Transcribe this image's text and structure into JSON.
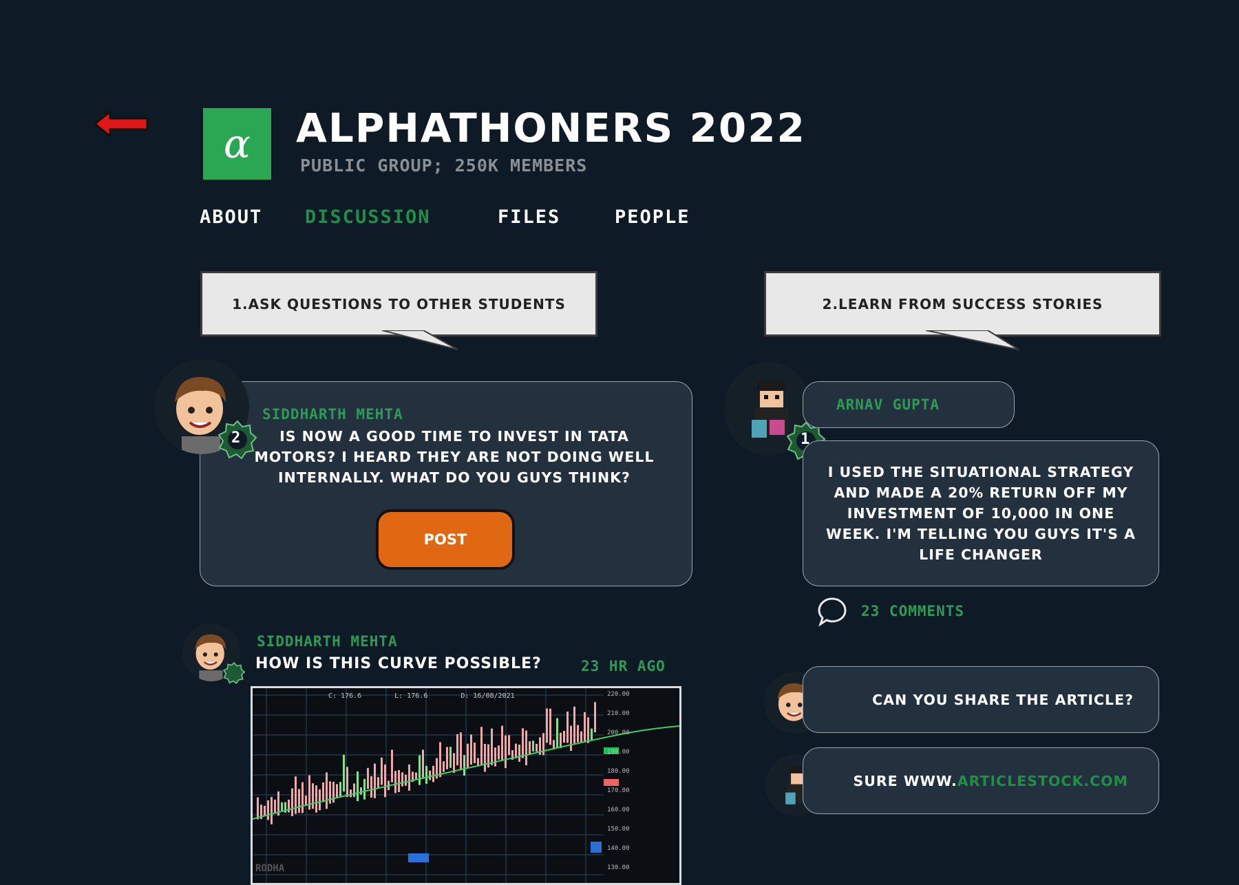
{
  "group": {
    "logo_glyph": "α",
    "title": "ALPHATHONERS 2022",
    "subtitle": "PUBLIC GROUP; 250K MEMBERS"
  },
  "tabs": [
    {
      "label": "ABOUT",
      "active": false
    },
    {
      "label": "DISCUSSION",
      "active": true
    },
    {
      "label": "FILES",
      "active": false
    },
    {
      "label": "PEOPLE",
      "active": false
    }
  ],
  "callouts": {
    "left": "1.ASK QUESTIONS TO OTHER STUDENTS",
    "right": "2.LEARN FROM SUCCESS STORIES"
  },
  "compose": {
    "author": "SIDDHARTH MEHTA",
    "badge": "2",
    "text": "IS NOW A GOOD TIME TO INVEST IN TATA MOTORS? I HEARD THEY ARE NOT DOING WELL INTERNALLY. WHAT DO YOU GUYS THINK?",
    "post_label": "POST"
  },
  "feed_post": {
    "author": "SIDDHARTH MEHTA",
    "text": "HOW IS THIS CURVE POSSIBLE?",
    "time": "23 HR AGO",
    "chart_header": [
      "C: 176.6",
      "L: 176.6",
      "D: 16/08/2021"
    ],
    "chart_axis": [
      "220.00",
      "210.00",
      "200.00",
      "190.00",
      "180.00",
      "170.00",
      "160.00",
      "150.00",
      "140.00",
      "130.00"
    ],
    "chart_watermark": "RODHA"
  },
  "story": {
    "author": "ARNAV GUPTA",
    "badge": "1",
    "text": "I USED THE SITUATIONAL STRATEGY AND MADE A 20% RETURN OFF MY INVESTMENT OF 10,000 IN ONE WEEK. I'M TELLING YOU GUYS IT'S A LIFE CHANGER",
    "comments": "23 COMMENTS"
  },
  "replies": [
    {
      "text": "CAN YOU SHARE THE ARTICLE?"
    },
    {
      "text_prefix": "SURE WWW.",
      "link": "ARTICLESTOCK.COM"
    }
  ],
  "colors": {
    "background": "#0e1b26",
    "accent_green": "#1f8f45",
    "post_orange": "#e06812",
    "card": "#22313d"
  },
  "icons": [
    "back-arrow-icon",
    "alpha-logo-icon",
    "comment-bubble-icon",
    "level-badge-icon"
  ]
}
